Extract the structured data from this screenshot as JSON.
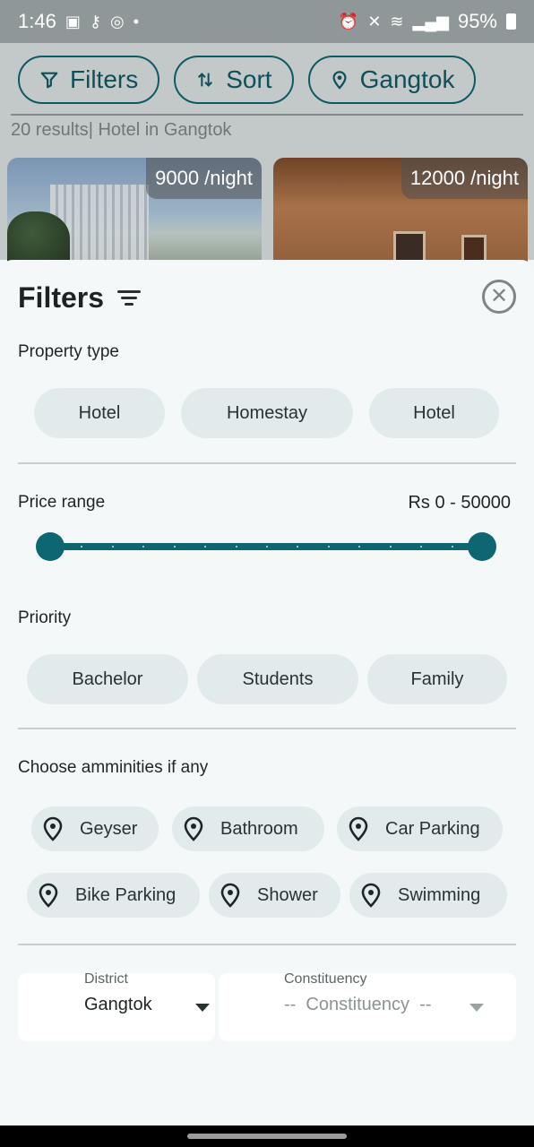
{
  "status_bar": {
    "time": "1:46",
    "battery": "95%"
  },
  "toolbar": {
    "filters_label": "Filters",
    "sort_label": "Sort",
    "location_label": "Gangtok"
  },
  "results": {
    "summary": "20 results| Hotel in Gangtok",
    "cards": [
      {
        "price": "9000 /night"
      },
      {
        "price": "12000 /night"
      }
    ]
  },
  "sheet": {
    "title": "Filters",
    "property_type": {
      "label": "Property type",
      "options": [
        "Hotel",
        "Homestay",
        "Hotel"
      ]
    },
    "price_range": {
      "label": "Price range",
      "value": "Rs 0 - 50000",
      "min_fraction": 0,
      "max_fraction": 1
    },
    "priority": {
      "label": "Priority",
      "options": [
        "Bachelor",
        "Students",
        "Family"
      ]
    },
    "amenities": {
      "label": "Choose amminities if any",
      "options": [
        "Geyser",
        "Bathroom",
        "Car Parking",
        "Bike Parking",
        "Shower",
        "Swimming"
      ],
      "icon": "location-pin-icon"
    },
    "district": {
      "label": "District",
      "value": "Gangtok"
    },
    "constituency": {
      "label": "Constituency",
      "placeholder": "--  Constituency  --"
    }
  },
  "colors": {
    "accent": "#0d6672",
    "chip_bg": "#e1ebeb",
    "sheet_bg": "#f4f8f8"
  }
}
